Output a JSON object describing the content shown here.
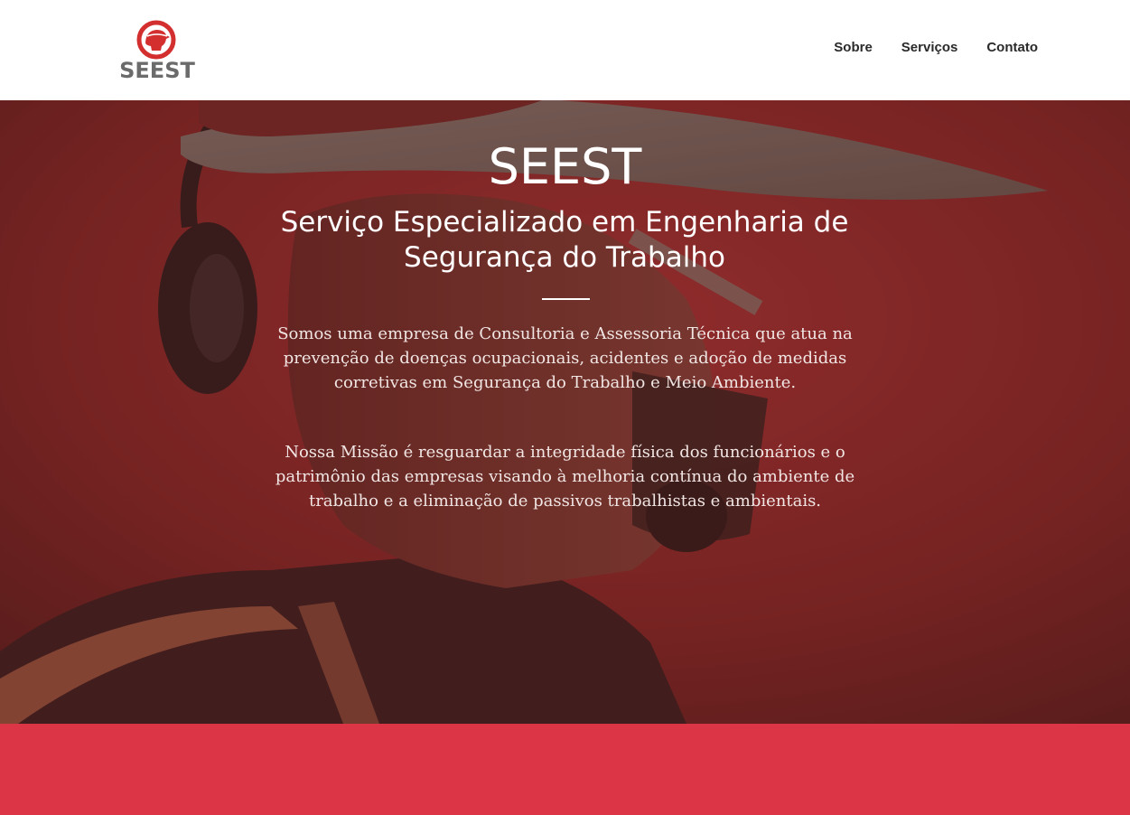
{
  "header": {
    "logo_text": "SEEST",
    "nav": [
      {
        "label": "Sobre"
      },
      {
        "label": "Serviços"
      },
      {
        "label": "Contato"
      }
    ]
  },
  "hero": {
    "title": "SEEST",
    "subtitle": "Serviço Especializado em Engenharia de Segurança do Trabalho",
    "paragraph_1": "Somos uma empresa de Consultoria e Assessoria Técnica que atua na prevenção de doenças ocupacionais, acidentes e adoção de medidas corretivas em Segurança do Trabalho e Meio Ambiente.",
    "paragraph_2": "Nossa Missão é resguardar a integridade física dos funcionários e o patrimônio das empresas visando à melhoria contínua do ambiente de trabalho e a eliminação de passivos trabalhistas e ambientais."
  },
  "colors": {
    "brand_red": "#dc3545",
    "logo_gray": "#6b6b6b",
    "hero_tint": "#7a2b28"
  },
  "icons": {
    "logo_mark": "helmet-head-circle-icon"
  }
}
